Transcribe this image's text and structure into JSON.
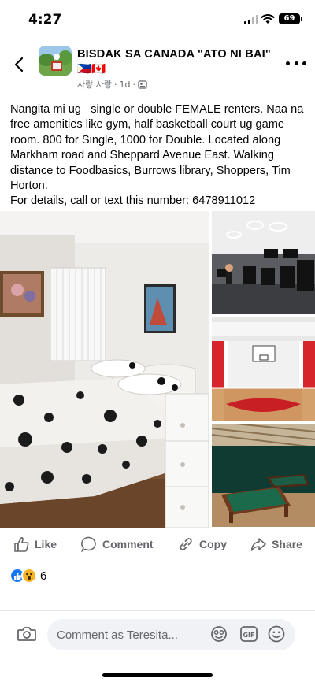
{
  "status": {
    "time": "4:27",
    "battery": "69"
  },
  "header": {
    "group_name": "BISDAK SA CANADA   \"ATO NI BAI\" 🇵🇭🇨🇦",
    "author": "사랑 사랑",
    "timestamp": "1d",
    "separator": "·"
  },
  "post": {
    "text": "Nangita mi ug   single or double FEMALE renters. Naa na free amenities like gym, half basketball court ug game room. 800 for Single, 1000 for Double. Located along Markham road and Sheppard Avenue East. Walking distance to Foodbasics, Burrows library, Shoppers, Tim Horton.\nFor details, call or text this number: 6478911012"
  },
  "photos": [
    {
      "name": "bedroom"
    },
    {
      "name": "gym"
    },
    {
      "name": "basketball court"
    },
    {
      "name": "game room"
    }
  ],
  "actions": {
    "like": "Like",
    "comment": "Comment",
    "copy": "Copy",
    "share": "Share"
  },
  "reactions": {
    "count": "6",
    "types": [
      "like",
      "wow"
    ]
  },
  "comment_bar": {
    "placeholder": "Comment as Teresita..."
  },
  "icons": {
    "back": "back-arrow-icon",
    "more": "more-dots-icon",
    "camera": "camera-icon",
    "sticker": "sticker-icon",
    "gif": "gif-icon",
    "emoji": "emoji-icon"
  },
  "colors": {
    "accent": "#1877f2",
    "secondary_text": "#65676b",
    "wow": "#f7b125"
  }
}
